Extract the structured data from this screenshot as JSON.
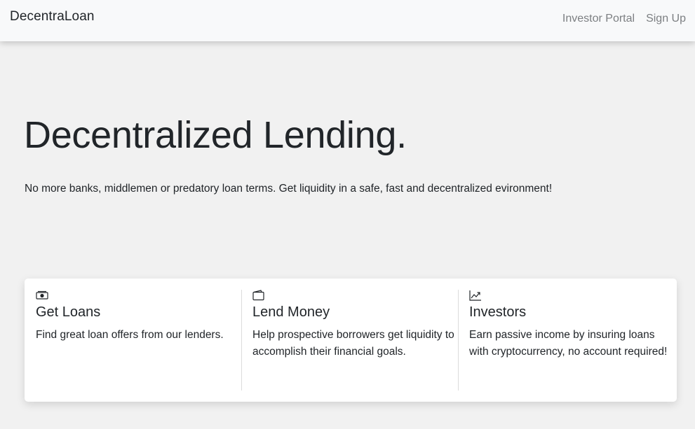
{
  "navbar": {
    "brand": "DecentraLoan",
    "links": [
      {
        "label": "Investor Portal"
      },
      {
        "label": "Sign Up"
      }
    ]
  },
  "hero": {
    "title": "Decentralized Lending.",
    "subtitle": "No more banks, middlemen or predatory loan terms. Get liquidity in a safe, fast and decentralized evironment!"
  },
  "features": [
    {
      "icon": "cash-icon",
      "title": "Get Loans",
      "text": "Find great loan offers from our lenders."
    },
    {
      "icon": "wallet-icon",
      "title": "Lend Money",
      "text": "Help prospective borrowers get liquidity to accomplish their financial goals."
    },
    {
      "icon": "graph-up-icon",
      "title": "Investors",
      "text": "Earn passive income by insuring loans with cryptocurrency, no account required!"
    }
  ]
}
